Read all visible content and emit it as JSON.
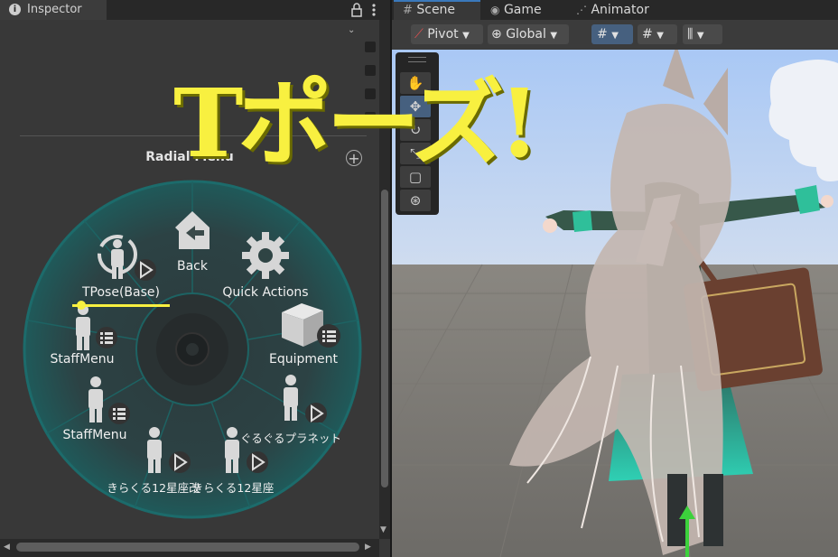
{
  "inspector": {
    "tab_label": "Inspector",
    "lock_icon": "lock-icon",
    "menu_icon": "kebab-menu-icon"
  },
  "radial_menu": {
    "title": "Radial Menu",
    "items": [
      {
        "label": "Back",
        "icon": "back-house-icon"
      },
      {
        "label": "Quick Actions",
        "icon": "gear-icon"
      },
      {
        "label": "Equipment",
        "icon": "box-submenu-icon"
      },
      {
        "label": "ぐるぐるプラネット",
        "icon": "person-play-icon"
      },
      {
        "label": "きらくる12星座",
        "icon": "person-play-icon"
      },
      {
        "label": "きらくる12星座改",
        "icon": "person-play-icon"
      },
      {
        "label": "StaffMenu",
        "icon": "person-submenu-icon"
      },
      {
        "label": "StaffMenu",
        "icon": "person-submenu-icon"
      },
      {
        "label": "TPose(Base)",
        "icon": "tpose-play-icon"
      }
    ]
  },
  "scene": {
    "tabs": [
      {
        "label": "Scene",
        "icon": "grid-icon"
      },
      {
        "label": "Game",
        "icon": "gamepad-icon"
      },
      {
        "label": "Animator",
        "icon": "animator-icon"
      }
    ],
    "toolbar": {
      "pivot_label": "Pivot",
      "global_label": "Global"
    }
  },
  "overlay_title": "Tポーズ!",
  "colors": {
    "accent_yellow": "#f8f040",
    "radial_bg": "#2f4f4f",
    "radial_teal": "#1f5c5c",
    "panel_bg": "#383838"
  }
}
